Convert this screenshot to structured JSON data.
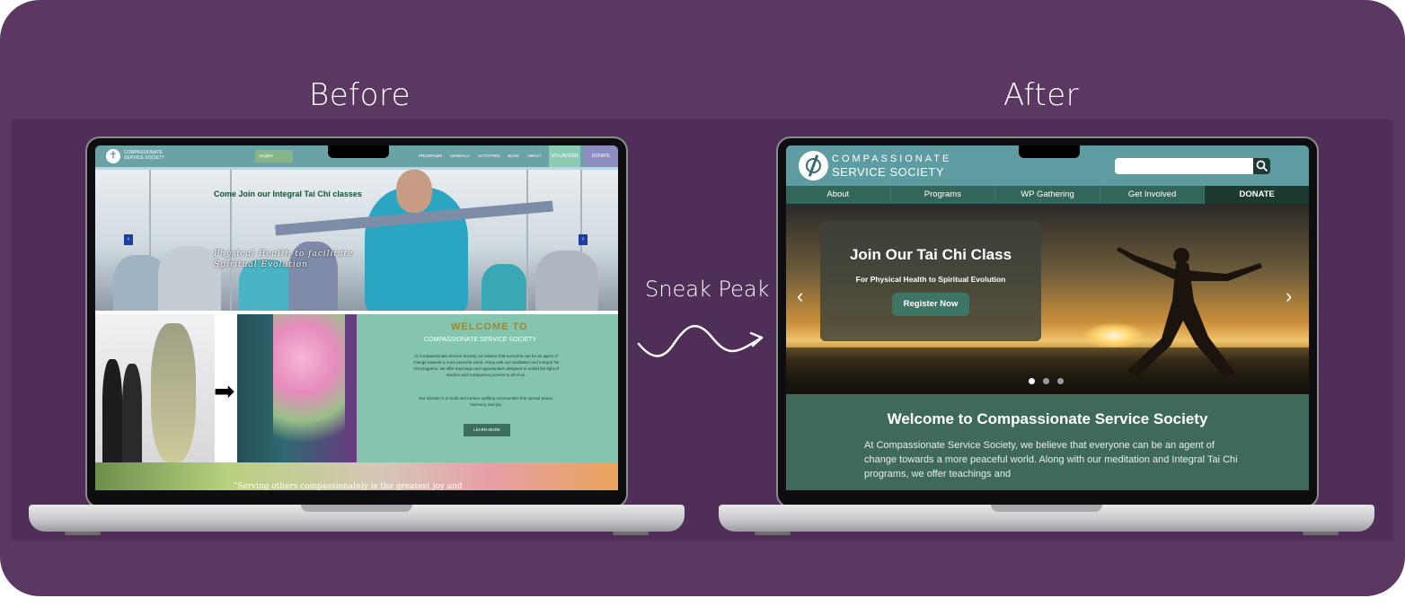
{
  "headings": {
    "before": "Before",
    "after": "After",
    "middle": "Sneak Peak"
  },
  "colors": {
    "background": "#5a3862",
    "band": "#4f2f57",
    "before_teal": "#6aa3a6",
    "after_teal": "#5e9ca2",
    "after_green": "#3f6a5b"
  },
  "before_site": {
    "brand": "COMPASSIONATE SERVICE SOCIETY",
    "language": "English",
    "nav": [
      "PROGRAMS",
      "MANDALA",
      "ACTIVITIES",
      "BLOG",
      "ABOUT"
    ],
    "volunteer": "VOLUNTEER",
    "donate": "DONATE",
    "hero_title": "Come Join our Integral Tai Chi classes",
    "hero_sub_line1": "Physical Health to facilitate",
    "hero_sub_line2": "Spiritual Evolution",
    "prev_arrow": "‹",
    "next_arrow": "›",
    "welcome_title": "WELCOME TO",
    "welcome_sub": "COMPASSIONATE SERVICE SOCIETY",
    "welcome_p1": "At Compassionate Service Society, we believe that everyone can be an agent of change towards a more peaceful world. Along with our meditation and Integral Tai Chi programs, we offer teachings and opportunities designed to unfold the light of wisdom and compassion present in all of us.",
    "welcome_p2": "Our mission is to build and nurture uplifting communities that spread peace, harmony, and joy.",
    "learn_more": "LEARN MORE",
    "quote": "\"Serving others compassionately is the greatest joy and"
  },
  "after_site": {
    "brand_line1": "COMPASSIONATE",
    "brand_line2": "SERVICE SOCIETY",
    "search_placeholder": "",
    "nav": [
      "About",
      "Programs",
      "WP Gathering",
      "Get Involved"
    ],
    "donate": "DONATE",
    "hero_title": "Join Our Tai Chi Class",
    "hero_sub": "For Physical Health to Spiritual Evolution",
    "hero_button": "Register Now",
    "prev_icon": "‹",
    "next_icon": "›",
    "slides": {
      "count": 3,
      "active": 1
    },
    "welcome_title": "Welcome to Compassionate Service Society",
    "welcome_text": "At Compassionate Service Society, we believe that everyone can be an agent of change towards a more peaceful world. Along with our meditation and Integral Tai Chi programs, we offer teachings and"
  }
}
